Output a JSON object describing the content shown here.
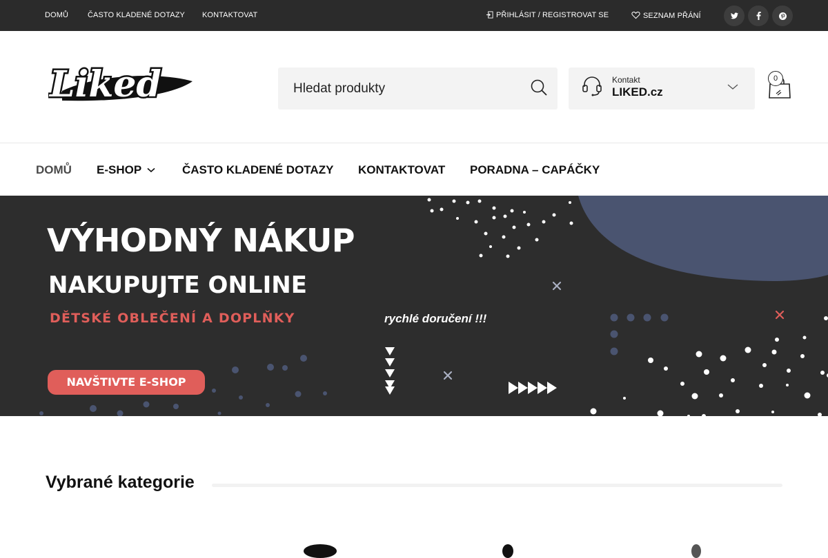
{
  "topbar": {
    "links": [
      "DOMŮ",
      "ČASTO KLADENÉ DOTAZY",
      "KONTAKTOVAT"
    ],
    "login": "PŘIHLÁSIT / REGISTROVAT SE",
    "wishlist": "SEZNAM PŘÁNÍ",
    "social": [
      "twitter-icon",
      "facebook-icon",
      "pinterest-icon"
    ]
  },
  "header": {
    "logo_text": "Liked",
    "search_placeholder": "Hledat produkty",
    "contact_label": "Kontakt",
    "contact_value": "LIKED.cz",
    "cart_count": "0"
  },
  "nav": {
    "items": [
      "DOMŮ",
      "E-SHOP",
      "ČASTO KLADENÉ DOTAZY",
      "KONTAKTOVAT",
      "PORADNA – CAPÁČKY"
    ]
  },
  "banner": {
    "headline": "VÝHODNÝ NÁKUP",
    "subheadline": "NAKUPUJTE ONLINE",
    "category_line": "DĚTSKÉ OBLEČENÍ A DOPLŇKY",
    "tagline": "rychlé doručení !!!",
    "cta": "NAVŠTIVTE E-SHOP"
  },
  "categories": {
    "title": "Vybrané kategorie"
  },
  "colors": {
    "topbar_bg": "#2b2b2b",
    "banner_bg": "#2d2d2d",
    "accent_red": "#e05e5a",
    "blob_blue": "#4a5470",
    "field_bg": "#f3f3f3"
  }
}
